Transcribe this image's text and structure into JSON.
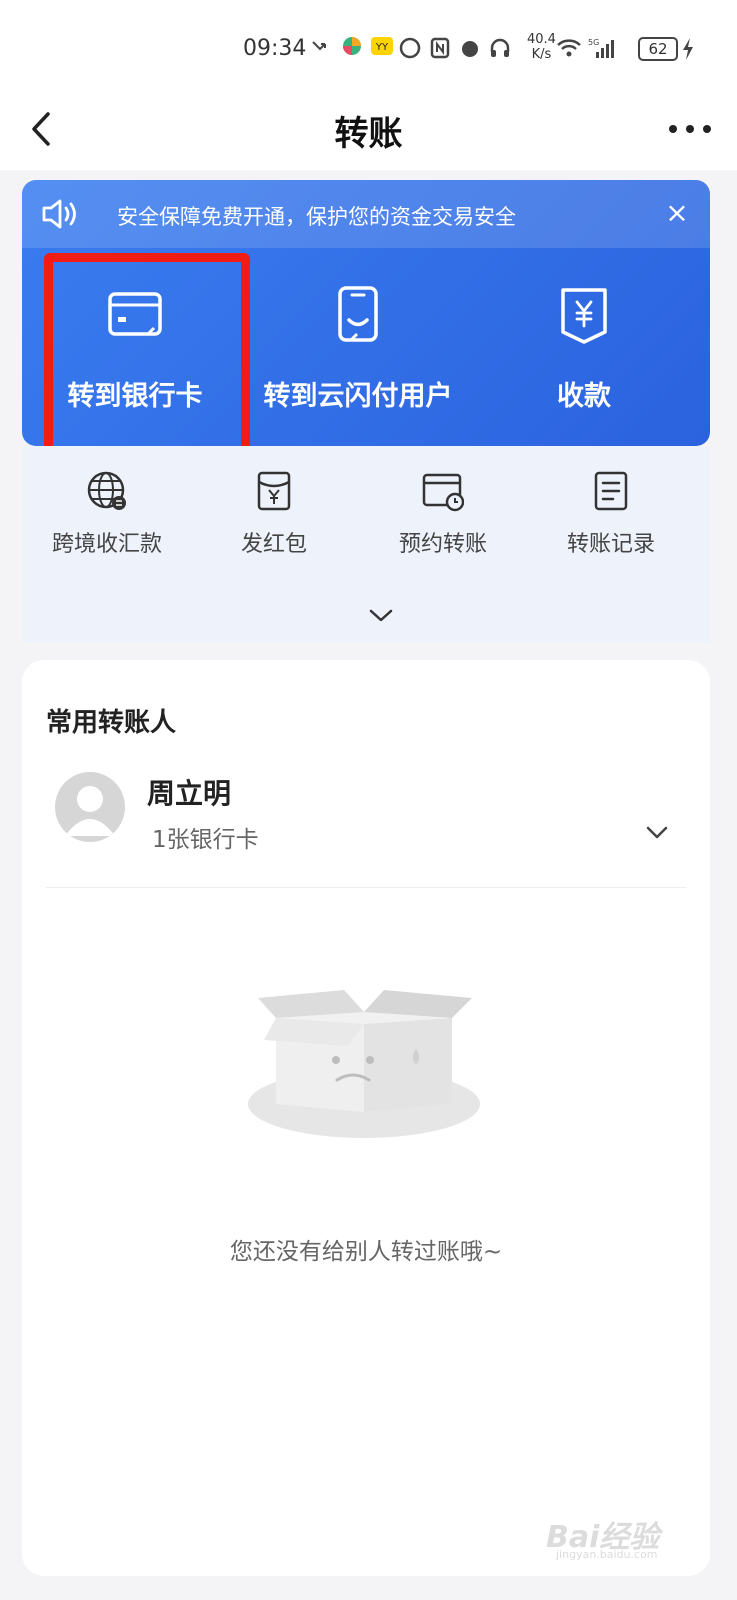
{
  "status_bar": {
    "time": "09:34",
    "net_speed_value": "40.4",
    "net_speed_unit": "K/s",
    "network": "5G",
    "battery": "62"
  },
  "nav": {
    "title": "转账"
  },
  "notice": {
    "text": "安全保障免费开通，保护您的资金交易安全",
    "close_label": "×"
  },
  "main_actions": [
    {
      "label": "转到银行卡",
      "icon": "bank-card-icon"
    },
    {
      "label": "转到云闪付用户",
      "icon": "user-phone-icon"
    },
    {
      "label": "收款",
      "icon": "yuan-receive-icon"
    }
  ],
  "sub_actions": [
    {
      "label": "跨境收汇款",
      "icon": "globe-icon"
    },
    {
      "label": "发红包",
      "icon": "red-envelope-icon"
    },
    {
      "label": "预约转账",
      "icon": "scheduled-transfer-icon"
    },
    {
      "label": "转账记录",
      "icon": "records-icon"
    }
  ],
  "frequent": {
    "title": "常用转账人",
    "contacts": [
      {
        "name": "周立明",
        "detail": "1张银行卡"
      }
    ]
  },
  "empty_state": {
    "text": "您还没有给别人转过账哦~"
  },
  "watermark": {
    "brand": "Bai经验",
    "url": "jingyan.baidu.com"
  },
  "colors": {
    "primary_blue": "#2b62de",
    "highlight_red": "#f11d15",
    "page_bg": "#f4f4f6"
  }
}
